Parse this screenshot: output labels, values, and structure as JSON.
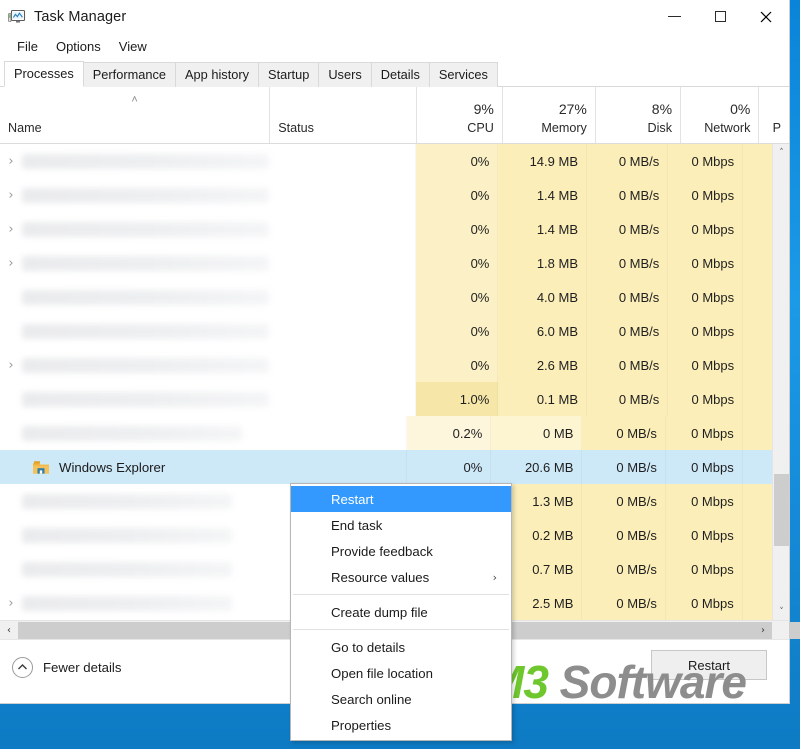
{
  "window": {
    "title": "Task Manager",
    "icon": "task-manager-icon",
    "minimize_label": "—",
    "maximize_label": "☐",
    "close_label": "✕"
  },
  "menubar": {
    "items": [
      {
        "label": "File"
      },
      {
        "label": "Options"
      },
      {
        "label": "View"
      }
    ]
  },
  "tabs": [
    {
      "label": "Processes",
      "active": true
    },
    {
      "label": "Performance",
      "active": false
    },
    {
      "label": "App history",
      "active": false
    },
    {
      "label": "Startup",
      "active": false
    },
    {
      "label": "Users",
      "active": false
    },
    {
      "label": "Details",
      "active": false
    },
    {
      "label": "Services",
      "active": false
    }
  ],
  "columns": [
    {
      "key": "name",
      "label": "Name",
      "pct": "",
      "sorted": true,
      "sort_arrow": "˄"
    },
    {
      "key": "status",
      "label": "Status",
      "pct": ""
    },
    {
      "key": "cpu",
      "label": "CPU",
      "pct": "9%"
    },
    {
      "key": "memory",
      "label": "Memory",
      "pct": "27%"
    },
    {
      "key": "disk",
      "label": "Disk",
      "pct": "8%"
    },
    {
      "key": "network",
      "label": "Network",
      "pct": "0%"
    },
    {
      "key": "power",
      "label": "P",
      "pct": ""
    }
  ],
  "rows": [
    {
      "name": "",
      "blurred": true,
      "expandable": true,
      "status": "",
      "cpu": "0%",
      "memory": "14.9 MB",
      "disk": "0 MB/s",
      "network": "0 Mbps",
      "selected": false
    },
    {
      "name": "",
      "blurred": true,
      "expandable": true,
      "status": "",
      "cpu": "0%",
      "memory": "1.4 MB",
      "disk": "0 MB/s",
      "network": "0 Mbps",
      "selected": false
    },
    {
      "name": "",
      "blurred": true,
      "expandable": true,
      "status": "",
      "cpu": "0%",
      "memory": "1.4 MB",
      "disk": "0 MB/s",
      "network": "0 Mbps",
      "selected": false
    },
    {
      "name": "",
      "blurred": true,
      "expandable": true,
      "status": "",
      "cpu": "0%",
      "memory": "1.8 MB",
      "disk": "0 MB/s",
      "network": "0 Mbps",
      "selected": false
    },
    {
      "name": "",
      "blurred": true,
      "expandable": false,
      "status": "",
      "cpu": "0%",
      "memory": "4.0 MB",
      "disk": "0 MB/s",
      "network": "0 Mbps",
      "selected": false
    },
    {
      "name": "",
      "blurred": true,
      "expandable": false,
      "status": "",
      "cpu": "0%",
      "memory": "6.0 MB",
      "disk": "0 MB/s",
      "network": "0 Mbps",
      "selected": false
    },
    {
      "name": "",
      "blurred": true,
      "expandable": true,
      "status": "",
      "cpu": "0%",
      "memory": "2.6 MB",
      "disk": "0 MB/s",
      "network": "0 Mbps",
      "selected": false
    },
    {
      "name": "",
      "blurred": true,
      "expandable": false,
      "status": "",
      "cpu": "1.0%",
      "memory": "0.1 MB",
      "disk": "0 MB/s",
      "network": "0 Mbps",
      "selected": false
    },
    {
      "name": "",
      "blurred": true,
      "expandable": false,
      "status": "",
      "cpu": "0.2%",
      "memory": "0 MB",
      "disk": "0 MB/s",
      "network": "0 Mbps",
      "selected": false
    },
    {
      "name": "Windows Explorer",
      "icon": "folder-icon",
      "blurred": false,
      "expandable": false,
      "status": "",
      "cpu": "0%",
      "memory": "20.6 MB",
      "disk": "0 MB/s",
      "network": "0 Mbps",
      "selected": true
    },
    {
      "name": "",
      "blurred": true,
      "expandable": false,
      "status": "",
      "cpu": "",
      "memory": "1.3 MB",
      "disk": "0 MB/s",
      "network": "0 Mbps",
      "selected": false
    },
    {
      "name": "",
      "blurred": true,
      "expandable": false,
      "status": "",
      "cpu": "",
      "memory": "0.2 MB",
      "disk": "0 MB/s",
      "network": "0 Mbps",
      "selected": false
    },
    {
      "name": "",
      "blurred": true,
      "expandable": false,
      "status": "",
      "cpu": "",
      "memory": "0.7 MB",
      "disk": "0 MB/s",
      "network": "0 Mbps",
      "selected": false
    },
    {
      "name": "",
      "blurred": true,
      "expandable": true,
      "status": "",
      "cpu": "",
      "memory": "2.5 MB",
      "disk": "0 MB/s",
      "network": "0 Mbps",
      "selected": false
    }
  ],
  "context_menu": {
    "items": [
      {
        "label": "Restart",
        "highlighted": true,
        "submenu": false,
        "separator_after": false
      },
      {
        "label": "End task",
        "highlighted": false,
        "submenu": false,
        "separator_after": false
      },
      {
        "label": "Provide feedback",
        "highlighted": false,
        "submenu": false,
        "separator_after": false
      },
      {
        "label": "Resource values",
        "highlighted": false,
        "submenu": true,
        "submenu_marker": "›",
        "separator_after": true
      },
      {
        "label": "Create dump file",
        "highlighted": false,
        "submenu": false,
        "separator_after": true
      },
      {
        "label": "Go to details",
        "highlighted": false,
        "submenu": false,
        "separator_after": false
      },
      {
        "label": "Open file location",
        "highlighted": false,
        "submenu": false,
        "separator_after": false
      },
      {
        "label": "Search online",
        "highlighted": false,
        "submenu": false,
        "separator_after": false
      },
      {
        "label": "Properties",
        "highlighted": false,
        "submenu": false,
        "separator_after": false
      }
    ]
  },
  "footer": {
    "fewer_details_label": "Fewer details",
    "fewer_details_icon": "chevron-up-circle-icon",
    "restart_button_label": "Restart"
  },
  "scrollbars": {
    "vertical_up": "˄",
    "vertical_down": "˅",
    "horizontal_left": "‹",
    "horizontal_right": "›"
  },
  "watermark": {
    "part1": "M3",
    "part2": " Software",
    "color1": "#6fc72e",
    "color2": "#8d8d8d"
  },
  "theme": {
    "accent": "#3399ff",
    "selection": "#cde8f7",
    "heat_yellow": "#fbeeb9",
    "desktop_blue": "#0a84d8"
  }
}
